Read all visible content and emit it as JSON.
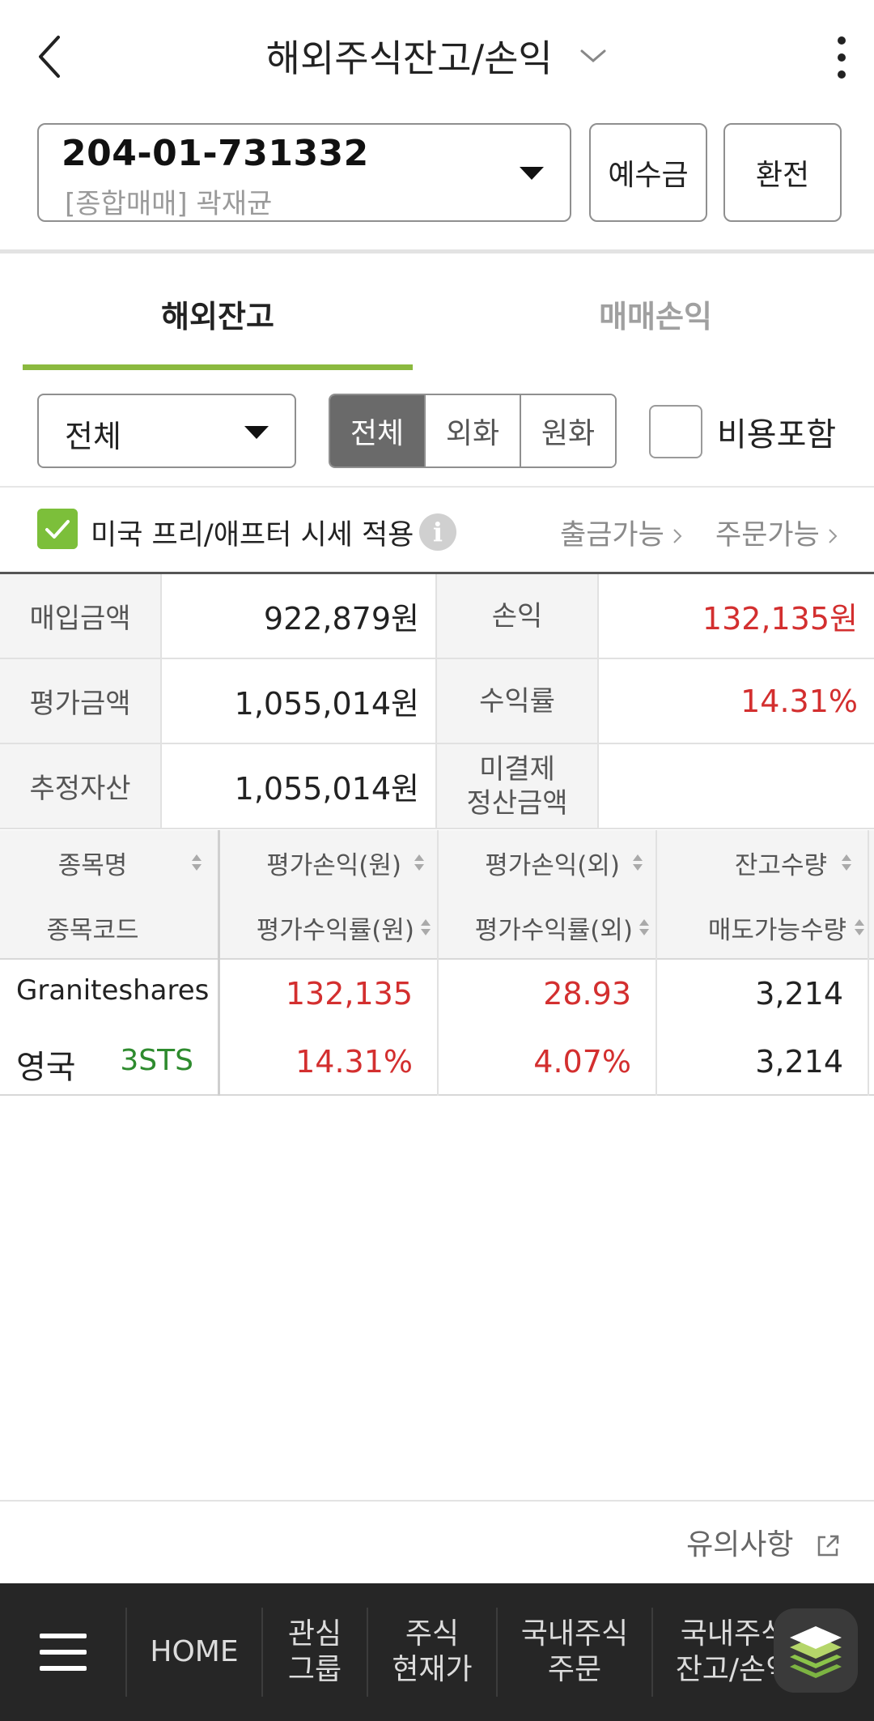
{
  "header": {
    "title": "해외주식잔고/손익"
  },
  "account": {
    "number": "204-01-731332",
    "subtitle": "[종합매매] 곽재균",
    "deposit_label": "예수금",
    "exchange_label": "환전"
  },
  "tabs": [
    {
      "label": "해외잔고",
      "active": true
    },
    {
      "label": "매매손익",
      "active": false
    }
  ],
  "filters": {
    "market_dropdown": "전체",
    "currency_segments": [
      "전체",
      "외화",
      "원화"
    ],
    "selected_segment": "전체",
    "include_fees_label": "비용포함",
    "include_fees_checked": false
  },
  "prepost": {
    "label": "미국 프리/애프터 시세 적용",
    "checked": true,
    "withdrawable_label": "출금가능",
    "orderable_label": "주문가능"
  },
  "summary": [
    {
      "label": "매입금액",
      "value": "922,879원",
      "label2": "손익",
      "value2": "132,135원"
    },
    {
      "label": "평가금액",
      "value": "1,055,014원",
      "label2": "수익률",
      "value2": "14.31%"
    },
    {
      "label": "추정자산",
      "value": "1,055,014원",
      "label2": "미결제\n정산금액",
      "value2": ""
    }
  ],
  "holdings": {
    "headers": {
      "col1_top": "종목명",
      "col1_bot": "종목코드",
      "col2_top": "평가손익(원)",
      "col2_bot": "평가수익률(원)",
      "col3_top": "평가손익(외)",
      "col3_bot": "평가수익률(외)",
      "col4_top": "잔고수량",
      "col4_bot": "매도가능수량"
    },
    "rows": [
      {
        "name": "Graniteshares",
        "country": "영국",
        "code": "3STS",
        "pnl_krw": "132,135",
        "return_krw": "14.31%",
        "pnl_fx": "28.93",
        "return_fx": "4.07%",
        "qty": "3,214",
        "sellable_qty": "3,214"
      }
    ]
  },
  "notice": {
    "label": "유의사항"
  },
  "bottom_nav": {
    "home": "HOME",
    "watch_line1": "관심",
    "watch_line2": "그룹",
    "price_line1": "주식",
    "price_line2": "현재가",
    "dorder_line1": "국내주식",
    "dorder_line2": "주문",
    "dbal_line1": "국내주식",
    "dbal_line2": "잔고/손익"
  },
  "colors": {
    "accent_green": "#8bb93f",
    "gain_red": "#d32f2f",
    "code_green": "#2e8b2e",
    "nav_bg": "#262626"
  }
}
